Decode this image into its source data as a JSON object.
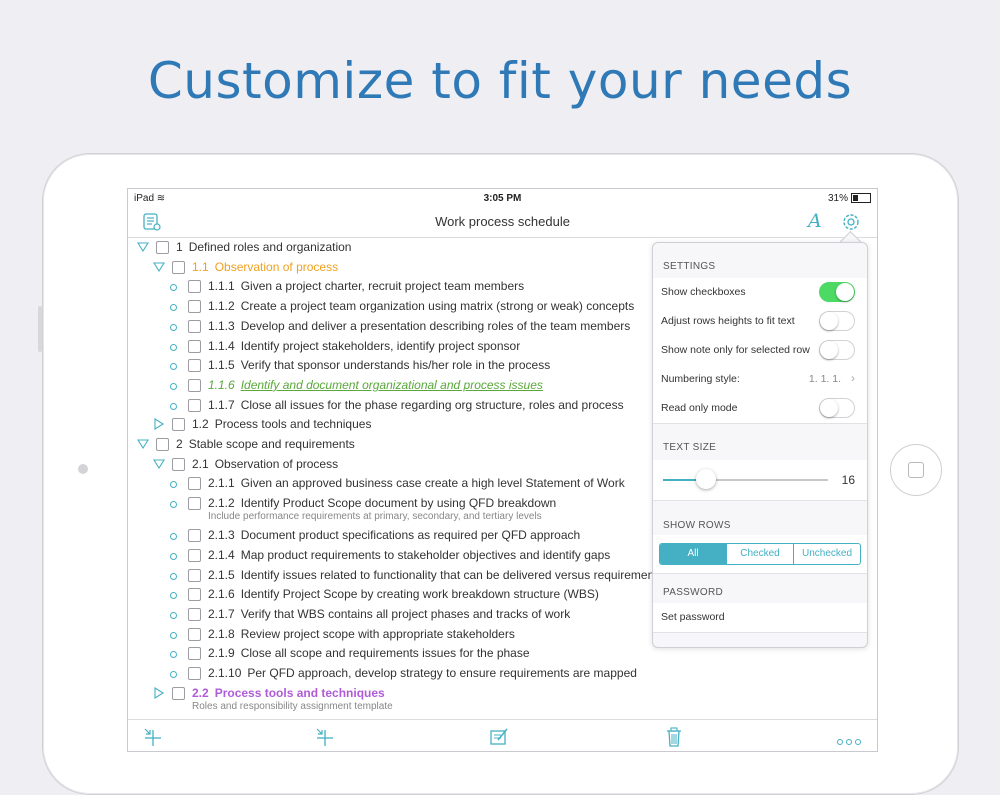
{
  "headline": "Customize to fit your needs",
  "status_bar": {
    "device": "iPad",
    "time": "3:05 PM",
    "battery": "31%"
  },
  "nav": {
    "title": "Work process schedule"
  },
  "rows": [
    {
      "num": "1",
      "text": "Defined roles and organization",
      "level": 0,
      "expander": "down"
    },
    {
      "num": "1.1",
      "text": "Observation of process",
      "level": 1,
      "expander": "down",
      "style": "orange"
    },
    {
      "num": "1.1.1",
      "text": "Given a project charter, recruit project team members",
      "level": 2,
      "expander": "bullet"
    },
    {
      "num": "1.1.2",
      "text": "Create a project team organization using matrix (strong or weak) concepts",
      "level": 2,
      "expander": "bullet"
    },
    {
      "num": "1.1.3",
      "text": "Develop and deliver a presentation describing roles of the team members",
      "level": 2,
      "expander": "bullet"
    },
    {
      "num": "1.1.4",
      "text": "Identify project stakeholders, identify project sponsor",
      "level": 2,
      "expander": "bullet"
    },
    {
      "num": "1.1.5",
      "text": "Verify that sponsor understands his/her role in the process",
      "level": 2,
      "expander": "bullet"
    },
    {
      "num": "1.1.6",
      "text": "Identify and document organizational and process issues",
      "level": 2,
      "expander": "bullet",
      "style": "green"
    },
    {
      "num": "1.1.7",
      "text": "Close all issues for the phase regarding org structure, roles and process",
      "level": 2,
      "expander": "bullet"
    },
    {
      "num": "1.2",
      "text": "Process tools and techniques",
      "level": 1,
      "expander": "right"
    },
    {
      "num": "2",
      "text": "Stable scope and requirements",
      "level": 0,
      "expander": "down"
    },
    {
      "num": "2.1",
      "text": "Observation of process",
      "level": 1,
      "expander": "down"
    },
    {
      "num": "2.1.1",
      "text": "Given an approved business case create a high level Statement of Work",
      "level": 2,
      "expander": "bullet"
    },
    {
      "num": "2.1.2",
      "text": "Identify Product Scope document by using QFD breakdown",
      "level": 2,
      "expander": "bullet",
      "note": "Include performance requirements at primary, secondary, and tertiary levels"
    },
    {
      "num": "2.1.3",
      "text": "Document product specifications as required per QFD approach",
      "level": 2,
      "expander": "bullet"
    },
    {
      "num": "2.1.4",
      "text": "Map product requirements to stakeholder objectives and identify gaps",
      "level": 2,
      "expander": "bullet"
    },
    {
      "num": "2.1.5",
      "text": "Identify issues related to functionality that can be delivered versus requirements",
      "level": 2,
      "expander": "bullet"
    },
    {
      "num": "2.1.6",
      "text": "Identify Project Scope by creating work breakdown structure (WBS)",
      "level": 2,
      "expander": "bullet"
    },
    {
      "num": "2.1.7",
      "text": "Verify that WBS contains all project phases and tracks of work",
      "level": 2,
      "expander": "bullet"
    },
    {
      "num": "2.1.8",
      "text": "Review project scope with appropriate stakeholders",
      "level": 2,
      "expander": "bullet"
    },
    {
      "num": "2.1.9",
      "text": "Close all scope and requirements issues for the phase",
      "level": 2,
      "expander": "bullet"
    },
    {
      "num": "2.1.10",
      "text": "Per QFD approach, develop strategy to ensure requirements are mapped",
      "level": 2,
      "expander": "bullet"
    },
    {
      "num": "2.2",
      "text": "Process tools and techniques",
      "level": 1,
      "expander": "right",
      "style": "purple",
      "note": "Roles and responsibility assignment template"
    }
  ],
  "settings": {
    "header": "SETTINGS",
    "show_checkboxes": {
      "label": "Show checkboxes",
      "on": true
    },
    "adjust_rows": {
      "label": "Adjust rows heights to fit text",
      "on": false
    },
    "show_note": {
      "label": "Show note only for selected row",
      "on": false
    },
    "numbering": {
      "label": "Numbering style:",
      "value": "1. 1. 1."
    },
    "read_only": {
      "label": "Read only mode",
      "on": false
    },
    "text_size_header": "TEXT SIZE",
    "text_size_value": "16",
    "text_size_fraction": 0.2,
    "show_rows_header": "SHOW ROWS",
    "show_rows_options": [
      "All",
      "Checked",
      "Unchecked"
    ],
    "show_rows_selected": "All",
    "password_header": "PASSWORD",
    "set_password": "Set password"
  },
  "colors": {
    "accent": "#45b0c4",
    "headline": "#2f79b7",
    "orange": "#f0a020",
    "green": "#5aa83a",
    "purple": "#b05cd8",
    "toggle_on": "#4cd964"
  }
}
